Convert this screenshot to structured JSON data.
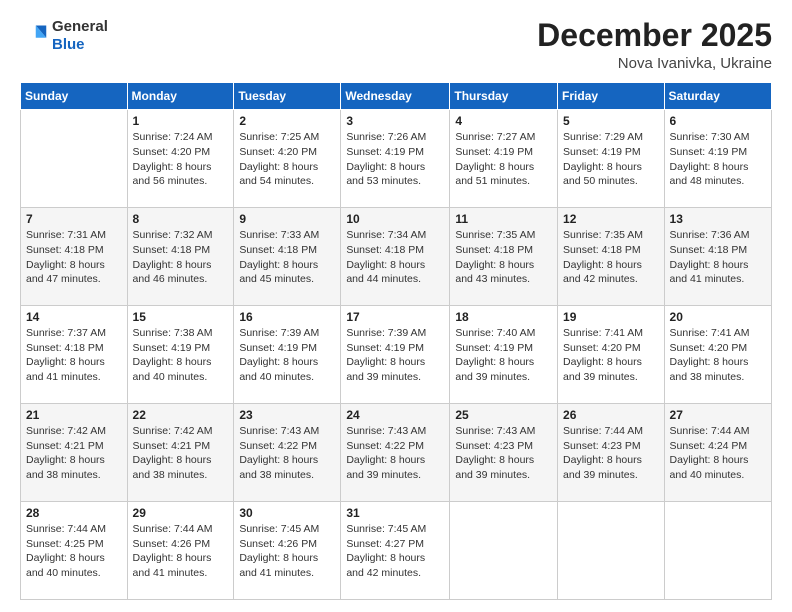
{
  "header": {
    "logo": {
      "general": "General",
      "blue": "Blue"
    },
    "title": "December 2025",
    "subtitle": "Nova Ivanivka, Ukraine"
  },
  "weekdays": [
    "Sunday",
    "Monday",
    "Tuesday",
    "Wednesday",
    "Thursday",
    "Friday",
    "Saturday"
  ],
  "weeks": [
    [
      {
        "day": "",
        "sunrise": "",
        "sunset": "",
        "daylight": ""
      },
      {
        "day": "1",
        "sunrise": "Sunrise: 7:24 AM",
        "sunset": "Sunset: 4:20 PM",
        "daylight": "Daylight: 8 hours and 56 minutes."
      },
      {
        "day": "2",
        "sunrise": "Sunrise: 7:25 AM",
        "sunset": "Sunset: 4:20 PM",
        "daylight": "Daylight: 8 hours and 54 minutes."
      },
      {
        "day": "3",
        "sunrise": "Sunrise: 7:26 AM",
        "sunset": "Sunset: 4:19 PM",
        "daylight": "Daylight: 8 hours and 53 minutes."
      },
      {
        "day": "4",
        "sunrise": "Sunrise: 7:27 AM",
        "sunset": "Sunset: 4:19 PM",
        "daylight": "Daylight: 8 hours and 51 minutes."
      },
      {
        "day": "5",
        "sunrise": "Sunrise: 7:29 AM",
        "sunset": "Sunset: 4:19 PM",
        "daylight": "Daylight: 8 hours and 50 minutes."
      },
      {
        "day": "6",
        "sunrise": "Sunrise: 7:30 AM",
        "sunset": "Sunset: 4:19 PM",
        "daylight": "Daylight: 8 hours and 48 minutes."
      }
    ],
    [
      {
        "day": "7",
        "sunrise": "Sunrise: 7:31 AM",
        "sunset": "Sunset: 4:18 PM",
        "daylight": "Daylight: 8 hours and 47 minutes."
      },
      {
        "day": "8",
        "sunrise": "Sunrise: 7:32 AM",
        "sunset": "Sunset: 4:18 PM",
        "daylight": "Daylight: 8 hours and 46 minutes."
      },
      {
        "day": "9",
        "sunrise": "Sunrise: 7:33 AM",
        "sunset": "Sunset: 4:18 PM",
        "daylight": "Daylight: 8 hours and 45 minutes."
      },
      {
        "day": "10",
        "sunrise": "Sunrise: 7:34 AM",
        "sunset": "Sunset: 4:18 PM",
        "daylight": "Daylight: 8 hours and 44 minutes."
      },
      {
        "day": "11",
        "sunrise": "Sunrise: 7:35 AM",
        "sunset": "Sunset: 4:18 PM",
        "daylight": "Daylight: 8 hours and 43 minutes."
      },
      {
        "day": "12",
        "sunrise": "Sunrise: 7:35 AM",
        "sunset": "Sunset: 4:18 PM",
        "daylight": "Daylight: 8 hours and 42 minutes."
      },
      {
        "day": "13",
        "sunrise": "Sunrise: 7:36 AM",
        "sunset": "Sunset: 4:18 PM",
        "daylight": "Daylight: 8 hours and 41 minutes."
      }
    ],
    [
      {
        "day": "14",
        "sunrise": "Sunrise: 7:37 AM",
        "sunset": "Sunset: 4:18 PM",
        "daylight": "Daylight: 8 hours and 41 minutes."
      },
      {
        "day": "15",
        "sunrise": "Sunrise: 7:38 AM",
        "sunset": "Sunset: 4:19 PM",
        "daylight": "Daylight: 8 hours and 40 minutes."
      },
      {
        "day": "16",
        "sunrise": "Sunrise: 7:39 AM",
        "sunset": "Sunset: 4:19 PM",
        "daylight": "Daylight: 8 hours and 40 minutes."
      },
      {
        "day": "17",
        "sunrise": "Sunrise: 7:39 AM",
        "sunset": "Sunset: 4:19 PM",
        "daylight": "Daylight: 8 hours and 39 minutes."
      },
      {
        "day": "18",
        "sunrise": "Sunrise: 7:40 AM",
        "sunset": "Sunset: 4:19 PM",
        "daylight": "Daylight: 8 hours and 39 minutes."
      },
      {
        "day": "19",
        "sunrise": "Sunrise: 7:41 AM",
        "sunset": "Sunset: 4:20 PM",
        "daylight": "Daylight: 8 hours and 39 minutes."
      },
      {
        "day": "20",
        "sunrise": "Sunrise: 7:41 AM",
        "sunset": "Sunset: 4:20 PM",
        "daylight": "Daylight: 8 hours and 38 minutes."
      }
    ],
    [
      {
        "day": "21",
        "sunrise": "Sunrise: 7:42 AM",
        "sunset": "Sunset: 4:21 PM",
        "daylight": "Daylight: 8 hours and 38 minutes."
      },
      {
        "day": "22",
        "sunrise": "Sunrise: 7:42 AM",
        "sunset": "Sunset: 4:21 PM",
        "daylight": "Daylight: 8 hours and 38 minutes."
      },
      {
        "day": "23",
        "sunrise": "Sunrise: 7:43 AM",
        "sunset": "Sunset: 4:22 PM",
        "daylight": "Daylight: 8 hours and 38 minutes."
      },
      {
        "day": "24",
        "sunrise": "Sunrise: 7:43 AM",
        "sunset": "Sunset: 4:22 PM",
        "daylight": "Daylight: 8 hours and 39 minutes."
      },
      {
        "day": "25",
        "sunrise": "Sunrise: 7:43 AM",
        "sunset": "Sunset: 4:23 PM",
        "daylight": "Daylight: 8 hours and 39 minutes."
      },
      {
        "day": "26",
        "sunrise": "Sunrise: 7:44 AM",
        "sunset": "Sunset: 4:23 PM",
        "daylight": "Daylight: 8 hours and 39 minutes."
      },
      {
        "day": "27",
        "sunrise": "Sunrise: 7:44 AM",
        "sunset": "Sunset: 4:24 PM",
        "daylight": "Daylight: 8 hours and 40 minutes."
      }
    ],
    [
      {
        "day": "28",
        "sunrise": "Sunrise: 7:44 AM",
        "sunset": "Sunset: 4:25 PM",
        "daylight": "Daylight: 8 hours and 40 minutes."
      },
      {
        "day": "29",
        "sunrise": "Sunrise: 7:44 AM",
        "sunset": "Sunset: 4:26 PM",
        "daylight": "Daylight: 8 hours and 41 minutes."
      },
      {
        "day": "30",
        "sunrise": "Sunrise: 7:45 AM",
        "sunset": "Sunset: 4:26 PM",
        "daylight": "Daylight: 8 hours and 41 minutes."
      },
      {
        "day": "31",
        "sunrise": "Sunrise: 7:45 AM",
        "sunset": "Sunset: 4:27 PM",
        "daylight": "Daylight: 8 hours and 42 minutes."
      },
      {
        "day": "",
        "sunrise": "",
        "sunset": "",
        "daylight": ""
      },
      {
        "day": "",
        "sunrise": "",
        "sunset": "",
        "daylight": ""
      },
      {
        "day": "",
        "sunrise": "",
        "sunset": "",
        "daylight": ""
      }
    ]
  ]
}
